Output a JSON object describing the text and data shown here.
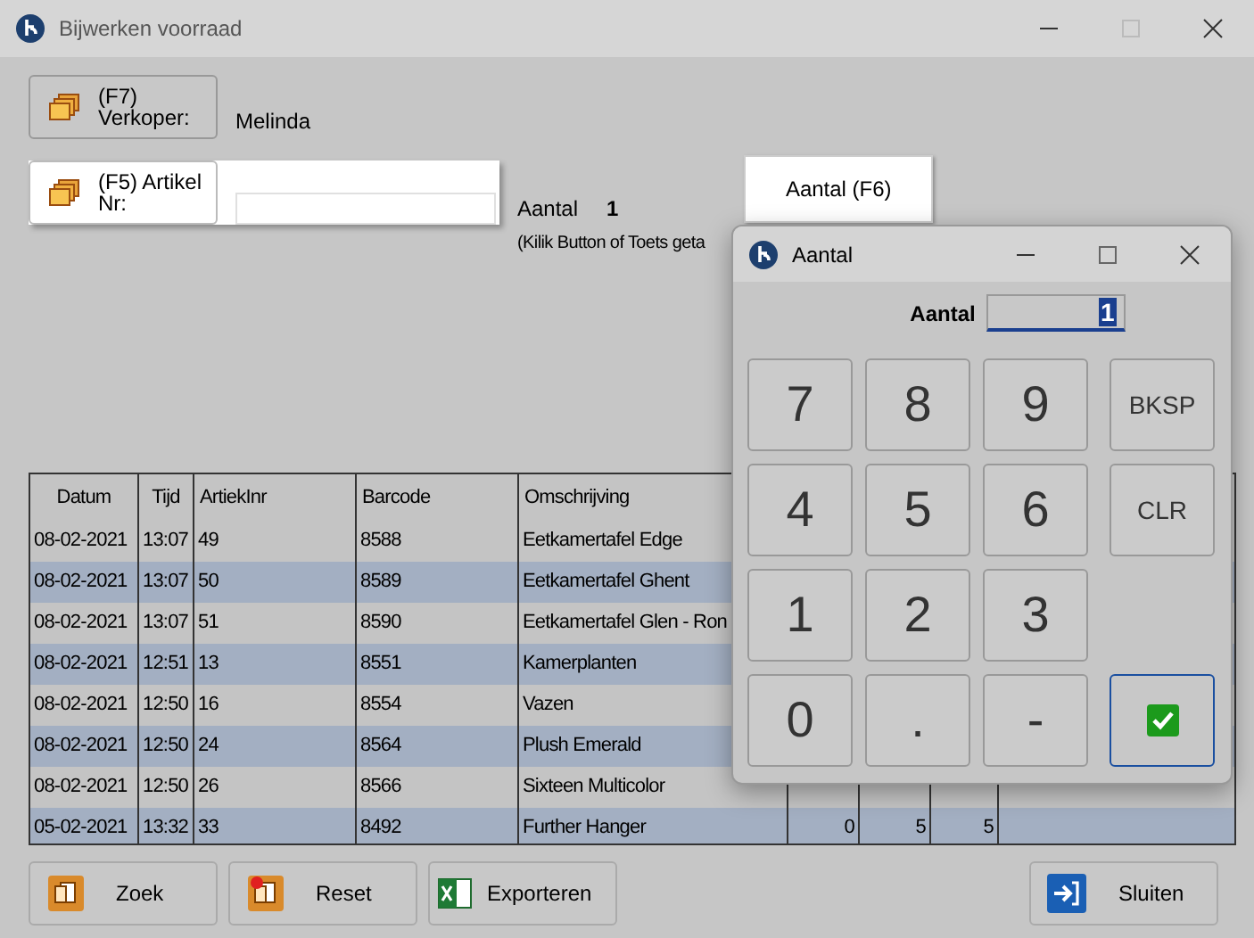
{
  "window": {
    "title": "Bijwerken voorraad"
  },
  "seller": {
    "button": [
      "(F7)",
      "Verkoper:"
    ],
    "value": "Melinda"
  },
  "article": {
    "button": [
      "(F5)  Artikel",
      "Nr:"
    ]
  },
  "quantity": {
    "label": "Aantal",
    "value": "1",
    "button": "Aantal (F6)",
    "hint": "(Kilik Button of Toets geta"
  },
  "table": {
    "columns": [
      "Datum",
      "Tijd",
      "ArtiekInr",
      "Barcode",
      "Omschrijving"
    ],
    "rows": [
      {
        "cells": [
          "08-02-2021",
          "13:07",
          "49",
          "8588",
          "Eetkamertafel Edge"
        ]
      },
      {
        "cells": [
          "08-02-2021",
          "13:07",
          "50",
          "8589",
          "Eetkamertafel Ghent"
        ]
      },
      {
        "cells": [
          "08-02-2021",
          "13:07",
          "51",
          "8590",
          "Eetkamertafel Glen - Ron"
        ]
      },
      {
        "cells": [
          "08-02-2021",
          "12:51",
          "13",
          "8551",
          "Kamerplanten"
        ]
      },
      {
        "cells": [
          "08-02-2021",
          "12:50",
          "16",
          "8554",
          "Vazen"
        ]
      },
      {
        "cells": [
          "08-02-2021",
          "12:50",
          "24",
          "8564",
          "Plush  Emerald"
        ]
      },
      {
        "cells": [
          "08-02-2021",
          "12:50",
          "26",
          "8566",
          "Sixteen  Multicolor"
        ]
      },
      {
        "cells": [
          "05-02-2021",
          "13:32",
          "33",
          "8492",
          "Further Hanger",
          "0",
          "5",
          "5"
        ]
      }
    ]
  },
  "buttons": [
    {
      "label": "Zoek",
      "kind": "search"
    },
    {
      "label": "Reset",
      "kind": "reset"
    },
    {
      "label": "Exporteren",
      "kind": "excel"
    },
    {
      "label": "Sluiten",
      "kind": "exit"
    }
  ],
  "dialog": {
    "title": "Aantal",
    "field_label": "Aantal",
    "field_value": "1",
    "keypad": [
      [
        {
          "label": "7",
          "kind": "digit"
        },
        {
          "label": "8",
          "kind": "digit"
        },
        {
          "label": "9",
          "kind": "digit"
        },
        {
          "label": "BKSP",
          "kind": "command"
        }
      ],
      [
        {
          "label": "4",
          "kind": "digit"
        },
        {
          "label": "5",
          "kind": "digit"
        },
        {
          "label": "6",
          "kind": "digit"
        },
        {
          "label": "CLR",
          "kind": "command"
        }
      ],
      [
        {
          "label": "1",
          "kind": "digit"
        },
        {
          "label": "2",
          "kind": "digit"
        },
        {
          "label": "3",
          "kind": "digit"
        }
      ],
      [
        {
          "label": "0",
          "kind": "digit"
        },
        {
          "label": ".",
          "kind": "digit"
        },
        {
          "label": "-",
          "kind": "digit"
        },
        {
          "kind": "confirm"
        }
      ]
    ]
  }
}
